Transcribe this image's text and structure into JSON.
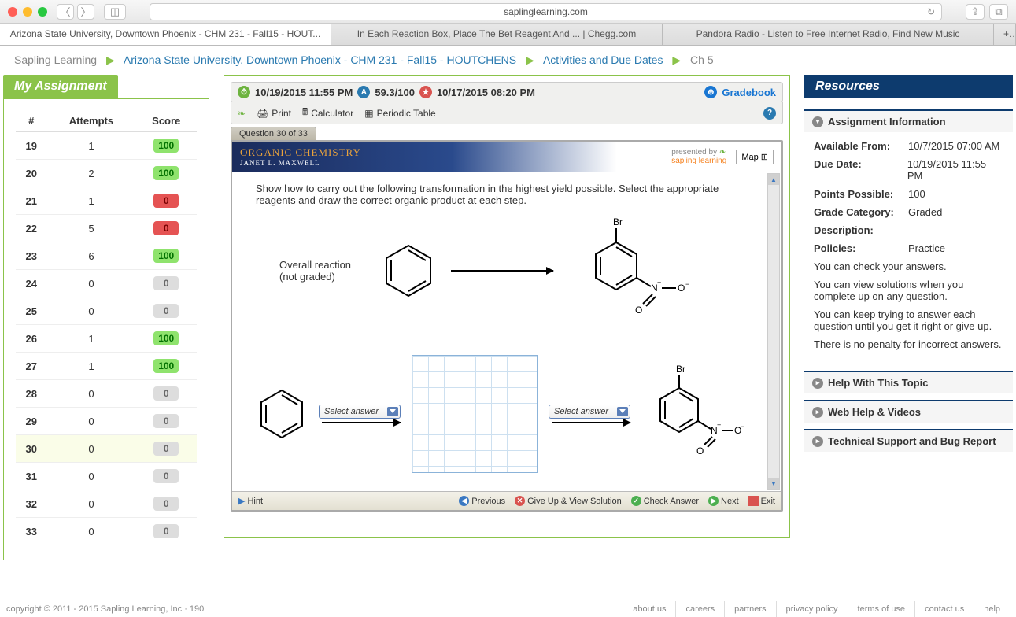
{
  "browser": {
    "url": "saplinglearning.com",
    "tabs": [
      "Arizona State University, Downtown Phoenix - CHM 231 - Fall15 - HOUT...",
      "In Each Reaction Box, Place The Bet Reagent And ... | Chegg.com",
      "Pandora Radio - Listen to Free Internet Radio, Find New Music"
    ]
  },
  "crumbs": {
    "root": "Sapling Learning",
    "course": "Arizona State University, Downtown Phoenix - CHM 231 - Fall15 - HOUTCHENS",
    "section": "Activities and Due Dates",
    "current": "Ch 5"
  },
  "left": {
    "title": "My Assignment",
    "headers": {
      "num": "#",
      "att": "Attempts",
      "score": "Score"
    },
    "rows": [
      {
        "n": "19",
        "a": "1",
        "s": "100",
        "c": "green"
      },
      {
        "n": "20",
        "a": "2",
        "s": "100",
        "c": "green"
      },
      {
        "n": "21",
        "a": "1",
        "s": "0",
        "c": "red"
      },
      {
        "n": "22",
        "a": "5",
        "s": "0",
        "c": "red"
      },
      {
        "n": "23",
        "a": "6",
        "s": "100",
        "c": "green"
      },
      {
        "n": "24",
        "a": "0",
        "s": "0",
        "c": "gray"
      },
      {
        "n": "25",
        "a": "0",
        "s": "0",
        "c": "gray"
      },
      {
        "n": "26",
        "a": "1",
        "s": "100",
        "c": "green"
      },
      {
        "n": "27",
        "a": "1",
        "s": "100",
        "c": "green"
      },
      {
        "n": "28",
        "a": "0",
        "s": "0",
        "c": "gray"
      },
      {
        "n": "29",
        "a": "0",
        "s": "0",
        "c": "gray"
      },
      {
        "n": "30",
        "a": "0",
        "s": "0",
        "c": "gray",
        "current": true
      },
      {
        "n": "31",
        "a": "0",
        "s": "0",
        "c": "gray"
      },
      {
        "n": "32",
        "a": "0",
        "s": "0",
        "c": "gray"
      },
      {
        "n": "33",
        "a": "0",
        "s": "0",
        "c": "gray"
      }
    ]
  },
  "info": {
    "due": "10/19/2015 11:55 PM",
    "score": "59.3/100",
    "saved": "10/17/2015 08:20 PM",
    "gradebook": "Gradebook",
    "print": "Print",
    "calc": "Calculator",
    "ptable": "Periodic Table"
  },
  "question": {
    "tab": "Question 30 of 33",
    "book": "ORGANIC CHEMISTRY",
    "author": "JANET L. MAXWELL",
    "presented": "presented by",
    "brand": "sapling learning",
    "map": "Map",
    "instr": "Show how to carry out the following transformation in the highest yield possible. Select the appropriate reagents and draw the correct organic product at each step.",
    "overall": "Overall reaction (not graded)",
    "select": "Select answer",
    "hint": "Hint",
    "prev": "Previous",
    "giveup": "Give Up & View Solution",
    "check": "Check Answer",
    "next": "Next",
    "exit": "Exit",
    "br": "Br"
  },
  "resources": {
    "title": "Resources",
    "h1": "Assignment Information",
    "info": {
      "avail_l": "Available From:",
      "avail_v": "10/7/2015 07:00 AM",
      "due_l": "Due Date:",
      "due_v": "10/19/2015 11:55 PM",
      "pts_l": "Points Possible:",
      "pts_v": "100",
      "grade_l": "Grade Category:",
      "grade_v": "Graded",
      "desc_l": "Description:",
      "pol_l": "Policies:",
      "pol_v": "Practice"
    },
    "p1": "You can check your answers.",
    "p2": "You can view solutions when you complete up on any question.",
    "p3": "You can keep trying to answer each question until you get it right or give up.",
    "p4": "There is no penalty for incorrect answers.",
    "h2": "Help With This Topic",
    "h3": "Web Help & Videos",
    "h4": "Technical Support and Bug Report"
  },
  "footer": {
    "copy": "copyright © 2011 - 2015 Sapling Learning, Inc · 190",
    "links": [
      "about us",
      "careers",
      "partners",
      "privacy policy",
      "terms of use",
      "contact us",
      "help"
    ]
  }
}
